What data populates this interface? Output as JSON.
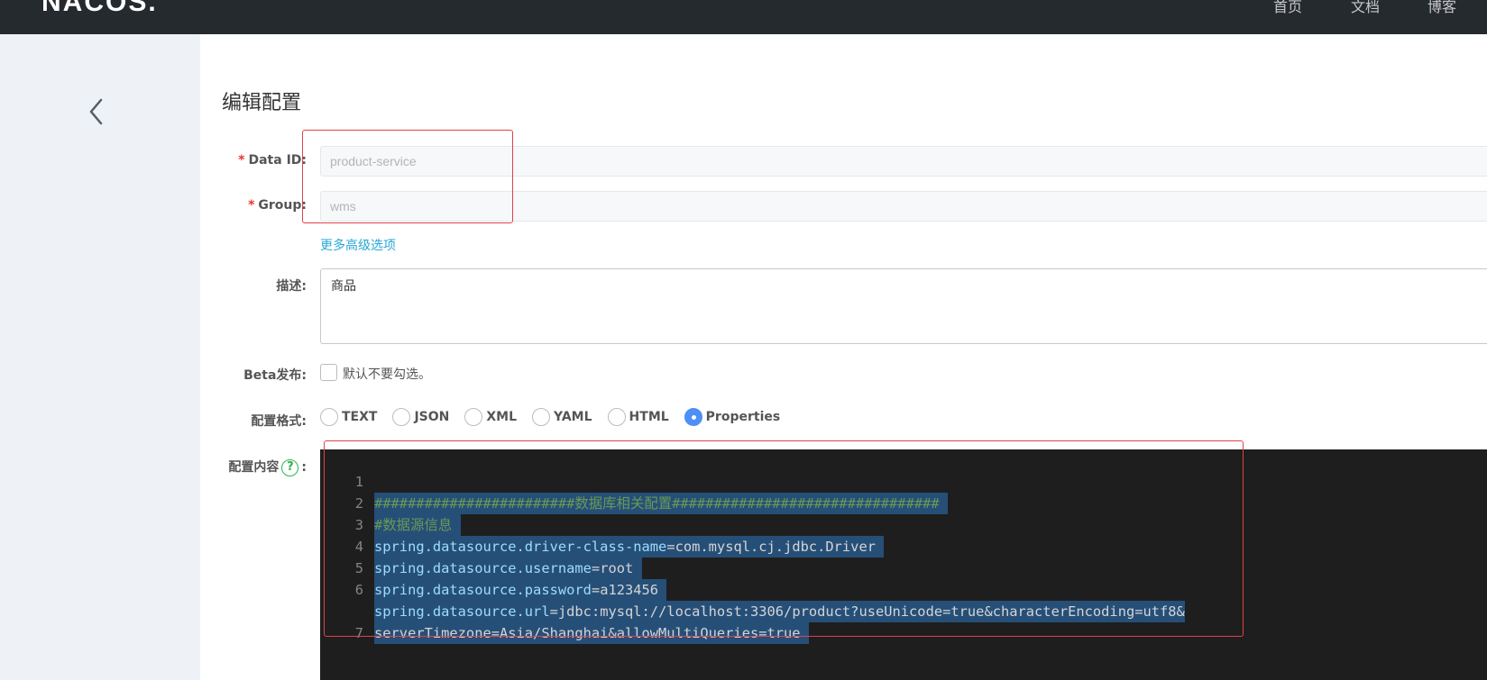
{
  "app": {
    "logo": "NACOS.",
    "nav": [
      "首页",
      "文档",
      "博客"
    ]
  },
  "page": {
    "title": "编辑配置"
  },
  "form": {
    "data_id": {
      "label": "Data ID:",
      "value": "product-service"
    },
    "group": {
      "label": "Group:",
      "value": "wms"
    },
    "advanced_link": "更多高级选项",
    "description": {
      "label": "描述:",
      "value": "商品"
    },
    "beta": {
      "label": "Beta发布:",
      "checkbox_label": "默认不要勾选。"
    },
    "format": {
      "label": "配置格式:",
      "options": [
        "TEXT",
        "JSON",
        "XML",
        "YAML",
        "HTML",
        "Properties"
      ],
      "selected": "Properties"
    },
    "content": {
      "label": "配置内容",
      "suffix": ":",
      "help_icon": "question-circle-icon"
    }
  },
  "editor": {
    "lines": [
      {
        "num": "1",
        "text": "########################数据库相关配置################################ ",
        "kind": "comment"
      },
      {
        "num": "2",
        "text": "#数据源信息 ",
        "kind": "comment"
      },
      {
        "num": "3",
        "key": "spring.datasource.driver-class-name",
        "value": "com.mysql.cj.jdbc.Driver ",
        "kind": "prop"
      },
      {
        "num": "4",
        "key": "spring.datasource.username",
        "value": "root ",
        "kind": "prop"
      },
      {
        "num": "5",
        "key": "spring.datasource.password",
        "value": "a123456 ",
        "kind": "prop"
      },
      {
        "num": "6",
        "key": "spring.datasource.url",
        "value": "jdbc:mysql://localhost:3306/product?useUnicode=true&characterEncoding=utf8&",
        "kind": "prop"
      },
      {
        "num": "",
        "text": "serverTimezone=Asia/Shanghai&allowMultiQueries=true ",
        "kind": "prop-cont"
      },
      {
        "num": "7",
        "text": "",
        "kind": "empty"
      }
    ]
  },
  "colors": {
    "topbar": "#252a2f",
    "sidebar": "#eef1f6",
    "annotation": "#e0424a",
    "link": "#28a8d8",
    "radio_selected": "#4d8ff7",
    "help": "#2eb24a"
  }
}
